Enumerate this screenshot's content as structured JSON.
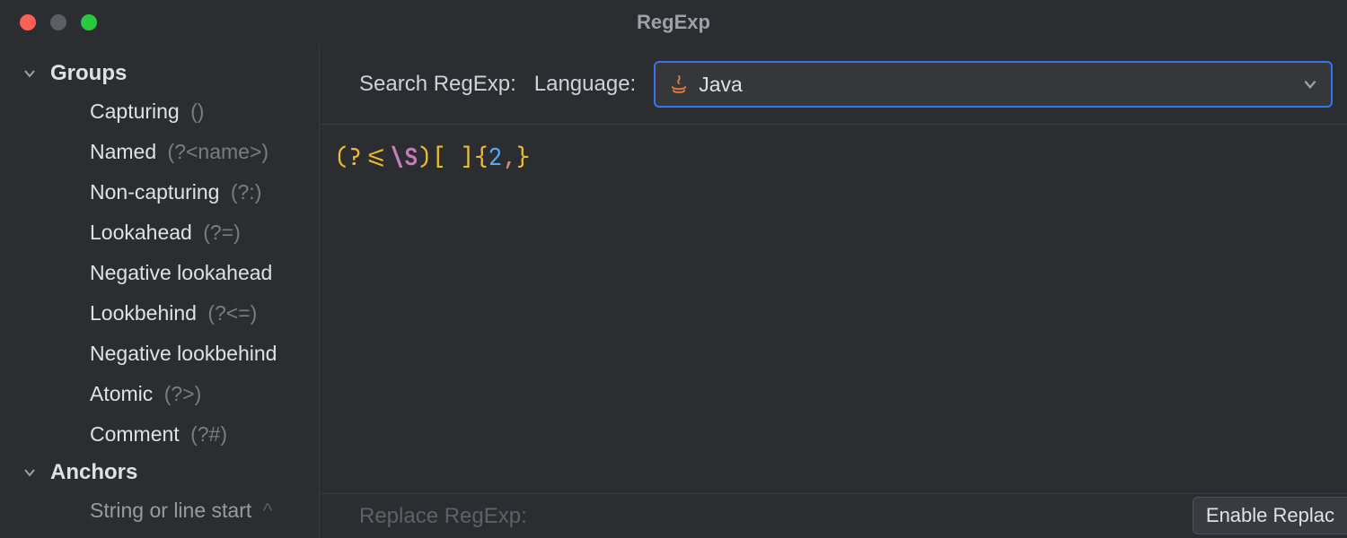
{
  "window": {
    "title": "RegExp"
  },
  "sidebar": {
    "groups_header": "Groups",
    "anchors_header": "Anchors",
    "group_items": [
      {
        "label": "Capturing",
        "hint": "()"
      },
      {
        "label": "Named",
        "hint": "(?<name>)"
      },
      {
        "label": "Non-capturing",
        "hint": "(?:)"
      },
      {
        "label": "Lookahead",
        "hint": "(?=)"
      },
      {
        "label": "Negative lookahead",
        "hint": ""
      },
      {
        "label": "Lookbehind",
        "hint": "(?<=)"
      },
      {
        "label": "Negative lookbehind",
        "hint": ""
      },
      {
        "label": "Atomic",
        "hint": "(?>)"
      },
      {
        "label": "Comment",
        "hint": "(?#)"
      }
    ],
    "anchor_first_item": {
      "label": "String or line start",
      "hint": "^"
    }
  },
  "toolbar": {
    "search_label": "Search RegExp:",
    "language_label": "Language:",
    "language_value": "Java",
    "language_icon": "coffee-cup-icon"
  },
  "editor": {
    "regex_display": "(?<=\\S)[ ]{2,}",
    "tokens": {
      "open": "(?<=",
      "esc": "\\S",
      "close_group": ")",
      "charclass": "[ ]",
      "brace_open": "{",
      "num": "2",
      "comma": ",",
      "brace_close": "}"
    }
  },
  "bottom": {
    "replace_label": "Replace RegExp:",
    "enable_replace_label": "Enable Replac"
  }
}
